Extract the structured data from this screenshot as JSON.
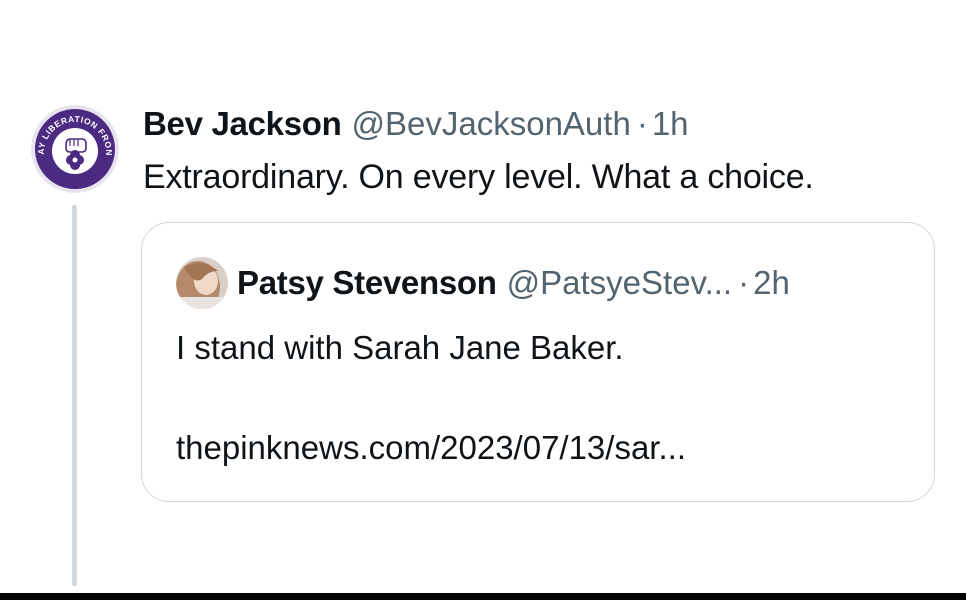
{
  "tweet": {
    "author_name": "Bev Jackson",
    "handle": "@BevJacksonAuth",
    "separator": "·",
    "time": "1h",
    "avatar_icon": "gay-liberation-front-badge-icon",
    "avatar_badge_text": "GAY LIBERATION FRONT",
    "text": "Extraordinary. On every level. What a choice."
  },
  "quoted_tweet": {
    "author_name": "Patsy Stevenson",
    "handle": "@PatsyeStev...",
    "separator": "·",
    "time": "2h",
    "avatar_icon": "profile-photo-icon",
    "text": "I stand with Sarah Jane Baker.",
    "link": "thepinknews.com/2023/07/13/sar..."
  },
  "colors": {
    "text_primary": "#0f1419",
    "text_secondary": "#536471",
    "border": "#cfd9de",
    "badge_purple": "#4b2a82"
  }
}
